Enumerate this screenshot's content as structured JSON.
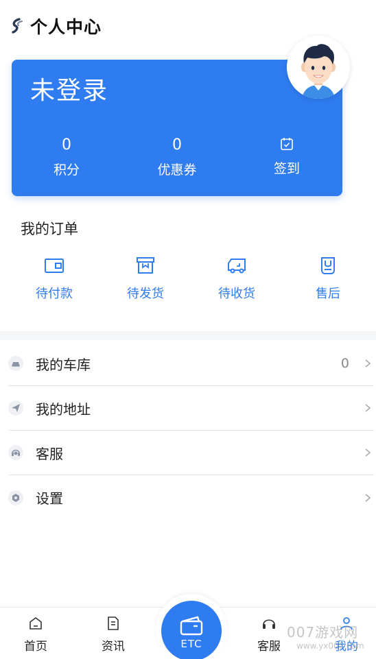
{
  "header": {
    "title": "个人中心",
    "logo_icon": "app-logo-icon"
  },
  "profile": {
    "login_status": "未登录",
    "avatar_icon": "cartoon-boy-avatar",
    "stats": [
      {
        "value": "0",
        "label": "积分"
      },
      {
        "value": "0",
        "label": "优惠券"
      },
      {
        "icon": "calendar-check-icon",
        "label": "签到"
      }
    ]
  },
  "orders": {
    "title": "我的订单",
    "items": [
      {
        "label": "待付款",
        "icon": "wallet-icon"
      },
      {
        "label": "待发货",
        "icon": "package-box-icon"
      },
      {
        "label": "待收货",
        "icon": "delivery-truck-icon"
      },
      {
        "label": "售后",
        "icon": "after-sale-bag-icon"
      }
    ]
  },
  "menu": [
    {
      "label": "我的车库",
      "value": "0",
      "icon": "car-icon"
    },
    {
      "label": "我的地址",
      "icon": "paper-plane-icon"
    },
    {
      "label": "客服",
      "icon": "headset-icon"
    },
    {
      "label": "设置",
      "icon": "gear-icon"
    }
  ],
  "bottom_nav": [
    {
      "label": "首页",
      "icon": "home-icon"
    },
    {
      "label": "资讯",
      "icon": "document-icon"
    },
    {
      "label": "ETC",
      "icon": "etc-card-icon"
    },
    {
      "label": "客服",
      "icon": "headphones-icon"
    },
    {
      "label": "我的",
      "icon": "user-icon"
    }
  ],
  "watermark": {
    "text": "007游戏网",
    "sub": "www.yx007.com"
  },
  "colors": {
    "accent": "#2f7cf0",
    "divider": "#e4e4e4",
    "band": "#f4f6f8"
  }
}
